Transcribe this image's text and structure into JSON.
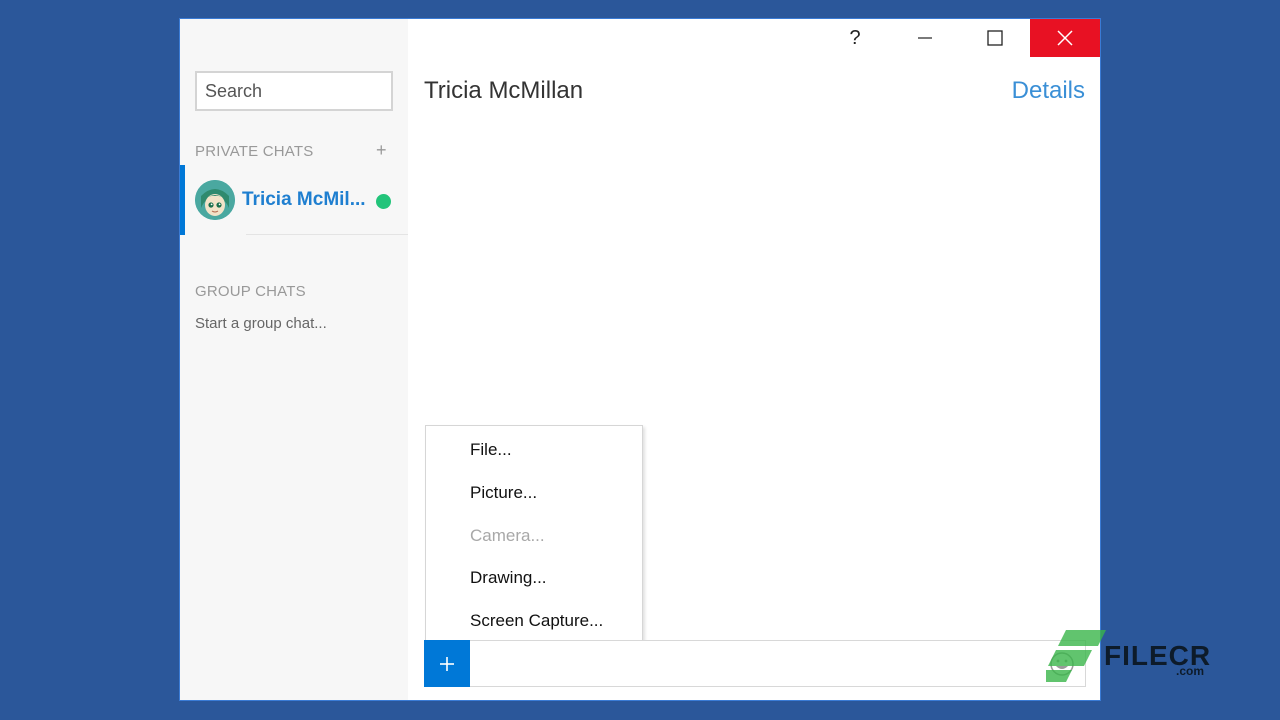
{
  "window": {
    "help_label": "?"
  },
  "sidebar": {
    "search_placeholder": "Search",
    "private_chats_label": "PRIVATE CHATS",
    "add_label": "+",
    "chats": [
      {
        "name": "Tricia McMil...",
        "status": "online"
      }
    ],
    "group_chats_label": "GROUP CHATS",
    "start_group_label": "Start a group chat..."
  },
  "chat": {
    "title": "Tricia McMillan",
    "details_label": "Details"
  },
  "attach_menu": {
    "items": [
      {
        "label": "File...",
        "enabled": true
      },
      {
        "label": "Picture...",
        "enabled": true
      },
      {
        "label": "Camera...",
        "enabled": false
      },
      {
        "label": "Drawing...",
        "enabled": true
      },
      {
        "label": "Screen Capture...",
        "enabled": true
      }
    ]
  },
  "composer": {
    "add_label": "+",
    "message_value": ""
  },
  "watermark": {
    "brand": "FILECR",
    "suffix": ".com"
  },
  "colors": {
    "desktop": "#2b579a",
    "accent": "#0078d7",
    "close": "#e81123",
    "online": "#22c47a",
    "link": "#3a8fd6"
  },
  "icons": [
    "help-icon",
    "minimize-icon",
    "maximize-icon",
    "close-icon",
    "add-icon",
    "emoji-icon",
    "avatar"
  ]
}
